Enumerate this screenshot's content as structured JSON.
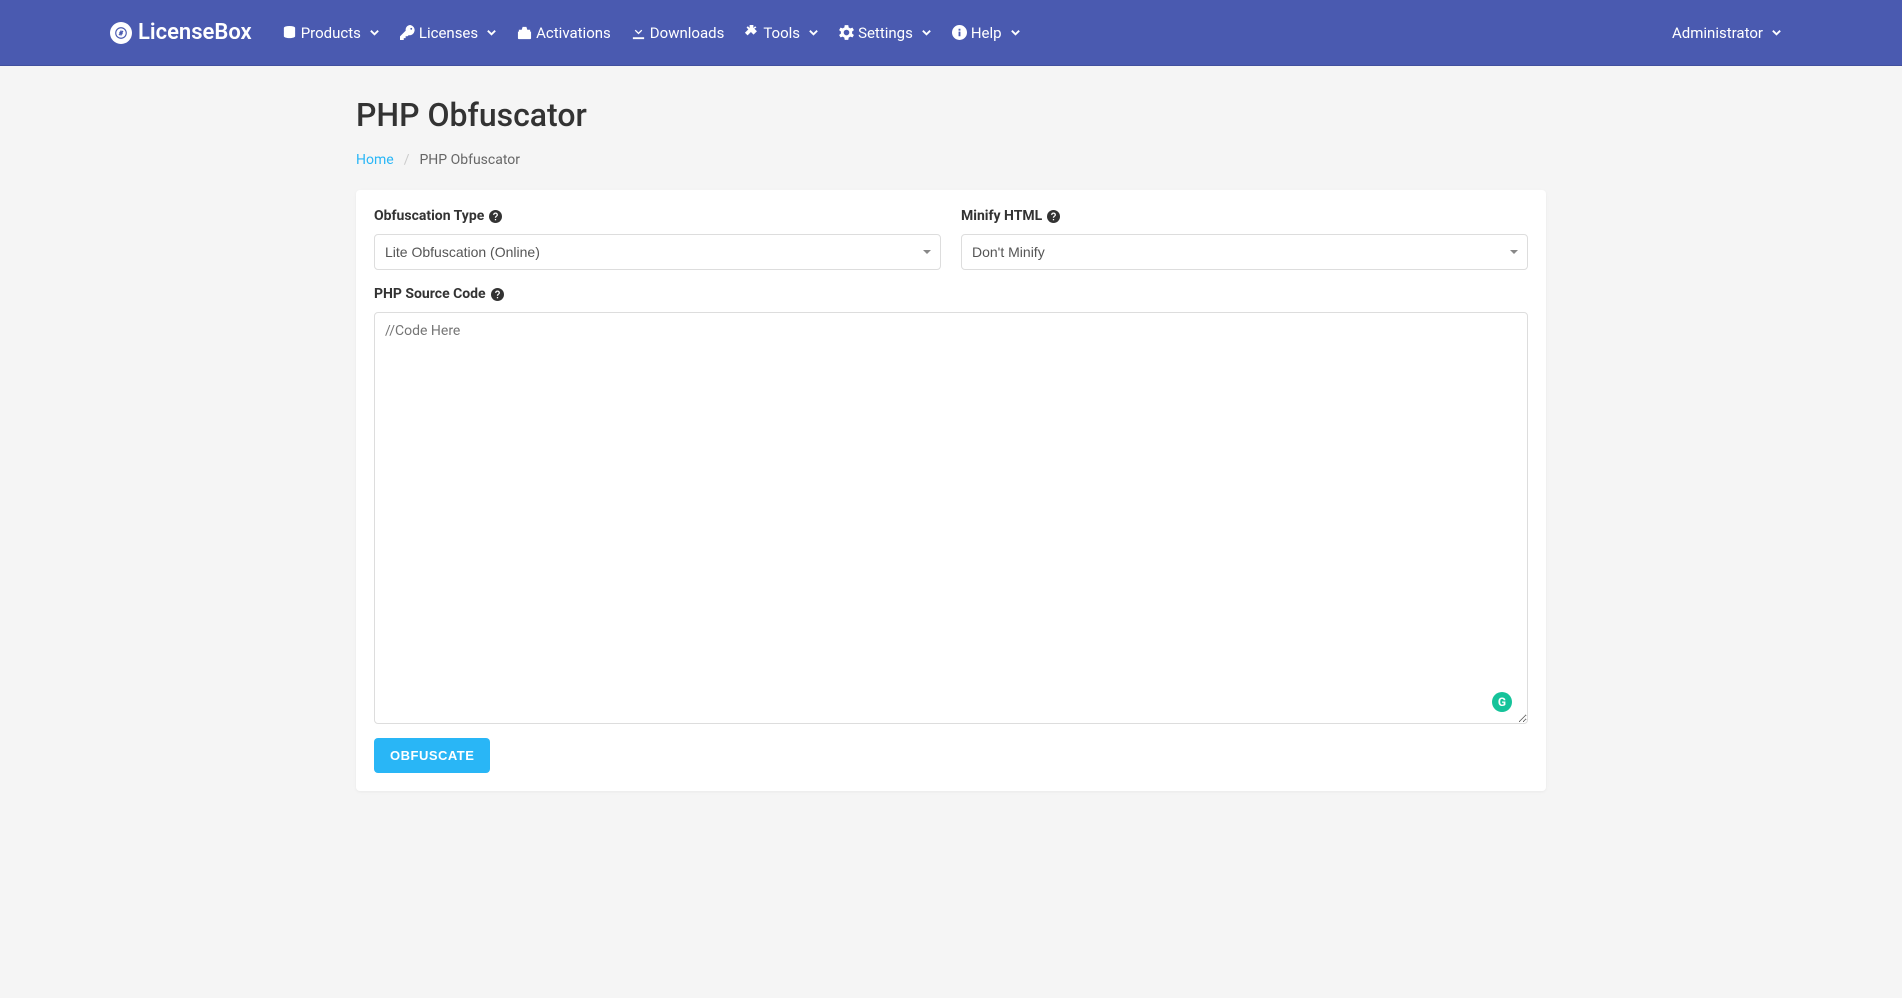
{
  "brand": "LicenseBox",
  "nav": {
    "products": "Products",
    "licenses": "Licenses",
    "activations": "Activations",
    "downloads": "Downloads",
    "tools": "Tools",
    "settings": "Settings",
    "help": "Help"
  },
  "user": "Administrator",
  "page": {
    "title": "PHP Obfuscator",
    "breadcrumb_home": "Home",
    "breadcrumb_current": "PHP Obfuscator"
  },
  "form": {
    "obfuscation_type_label": "Obfuscation Type",
    "obfuscation_type_value": "Lite Obfuscation (Online)",
    "minify_html_label": "Minify HTML",
    "minify_html_value": "Don't Minify",
    "source_code_label": "PHP Source Code",
    "source_code_placeholder": "//Code Here",
    "submit_label": "OBFUSCATE"
  }
}
